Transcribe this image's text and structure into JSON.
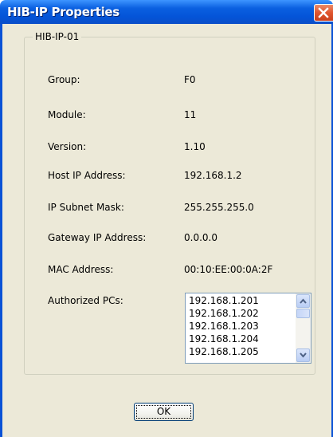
{
  "window": {
    "title": "HIB-IP Properties"
  },
  "group": {
    "label": "HIB-IP-01"
  },
  "fields": [
    {
      "label": "Group:",
      "value": "F0"
    },
    {
      "label": "Module:",
      "value": "11"
    },
    {
      "label": "Version:",
      "value": "1.10"
    },
    {
      "label": "Host IP Address:",
      "value": "192.168.1.2"
    },
    {
      "label": "IP Subnet Mask:",
      "value": "255.255.255.0"
    },
    {
      "label": "Gateway IP Address:",
      "value": "0.0.0.0"
    },
    {
      "label": "MAC Address:",
      "value": "00:10:EE:00:0A:2F"
    }
  ],
  "authorized_pcs": {
    "label": "Authorized PCs:",
    "items": [
      "192.168.1.201",
      "192.168.1.202",
      "192.168.1.203",
      "192.168.1.204",
      "192.168.1.205"
    ]
  },
  "buttons": {
    "ok": "OK"
  },
  "icons": {
    "close": "close-icon",
    "scroll_up": "scroll-up-arrow-icon",
    "scroll_down": "scroll-down-arrow-icon"
  },
  "colors": {
    "titlebar": "#0454d8",
    "client_background": "#ece9d8",
    "close_button": "#e0552e"
  }
}
